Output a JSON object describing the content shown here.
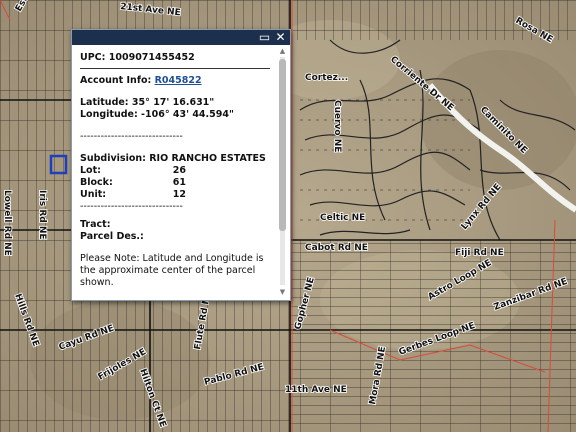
{
  "popup": {
    "upc": "UPC: 1009071455452",
    "account_label": "Account Info: ",
    "account_link": "R045822",
    "latitude": "Latitude: 35° 17' 16.631\"",
    "longitude": "Longitude: -106° 43' 44.594\"",
    "separator": "------------------------------",
    "subdivision": "Subdivision: RIO RANCHO ESTATES",
    "lot_label": "Lot:",
    "lot_value": "26",
    "block_label": "Block:",
    "block_value": "61",
    "unit_label": "Unit:",
    "unit_value": "12",
    "tract": "Tract:",
    "parcel_des": "Parcel Des.:",
    "note": "Please Note: Latitude and Longitude is the approximate center of the parcel shown.",
    "maximize_icon": "maximize-icon",
    "close_icon": "close-icon"
  },
  "map": {
    "road_labels": [
      "21st Ave NE",
      "Esteros...",
      "Cortez...",
      "Corriente Dr NE",
      "Caminito NE",
      "Fiji Rd NE",
      "Cabot Rd NE",
      "Cuervo NE",
      "Celtic NE",
      "Lynx Rd NE",
      "Lowell Rd NE",
      "Iris Rd NE",
      "Flute Rd NE",
      "Cayu Rd NE",
      "Frijoles NE",
      "Hilton Ct NE",
      "Gerbes Loop NE",
      "11th Ave NE",
      "Pablo Rd NE",
      "Mora Rd NE",
      "Rosa NE",
      "Zanzibar Rd NE",
      "Gopher NE",
      "Astro Loop NE",
      "Hills Rd NE"
    ],
    "colors": {
      "terrain": "#a89a80",
      "parcel_line": "#1a1a1a",
      "street_red": "#d94a3a",
      "selection": "#1f3fbf"
    }
  }
}
